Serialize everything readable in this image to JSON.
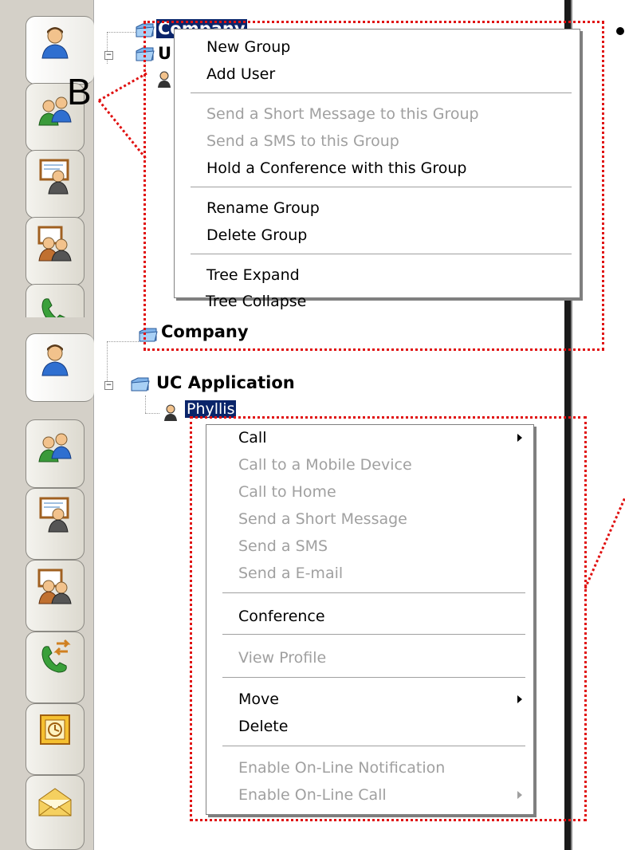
{
  "annotation": {
    "label": "B",
    "bullet": "bullet-point",
    "box_color": "#e01010"
  },
  "sidebar_tabs": [
    {
      "icon": "user-contacts-icon"
    },
    {
      "icon": "group-contacts-icon"
    },
    {
      "icon": "presentation-user-icon"
    },
    {
      "icon": "conference-users-icon"
    },
    {
      "icon": "call-transfer-icon"
    },
    {
      "icon": "outlook-calendar-icon"
    },
    {
      "icon": "envelope-icon"
    }
  ],
  "top_tree": {
    "company": "Company",
    "uc_app": "U"
  },
  "bottom_tree": {
    "company": "Company",
    "uc_app": "UC Application",
    "user": "Phyllis"
  },
  "group_menu": {
    "items": [
      {
        "label": "New Group",
        "enabled": true
      },
      {
        "label": "Add User",
        "enabled": true
      },
      {
        "label": "Send a Short Message to this Group",
        "enabled": false
      },
      {
        "label": "Send a SMS to this Group",
        "enabled": false
      },
      {
        "label": "Hold a Conference with this Group",
        "enabled": true
      },
      {
        "label": "Rename Group",
        "enabled": true
      },
      {
        "label": "Delete Group",
        "enabled": true
      },
      {
        "label": "Tree Expand",
        "enabled": true
      },
      {
        "label": "Tree Collapse",
        "enabled": true
      }
    ]
  },
  "user_menu": {
    "items": [
      {
        "label": "Call",
        "enabled": true,
        "submenu": true
      },
      {
        "label": "Call to a Mobile Device",
        "enabled": false
      },
      {
        "label": "Call to Home",
        "enabled": false
      },
      {
        "label": "Send a Short Message",
        "enabled": false
      },
      {
        "label": "Send a SMS",
        "enabled": false
      },
      {
        "label": "Send a E-mail",
        "enabled": false
      },
      {
        "label": "Conference",
        "enabled": true
      },
      {
        "label": "View Profile",
        "enabled": false
      },
      {
        "label": "Move",
        "enabled": true,
        "submenu": true
      },
      {
        "label": "Delete",
        "enabled": true
      },
      {
        "label": "Enable On-Line Notification",
        "enabled": false
      },
      {
        "label": "Enable On-Line Call",
        "enabled": false,
        "submenu": true
      }
    ]
  }
}
